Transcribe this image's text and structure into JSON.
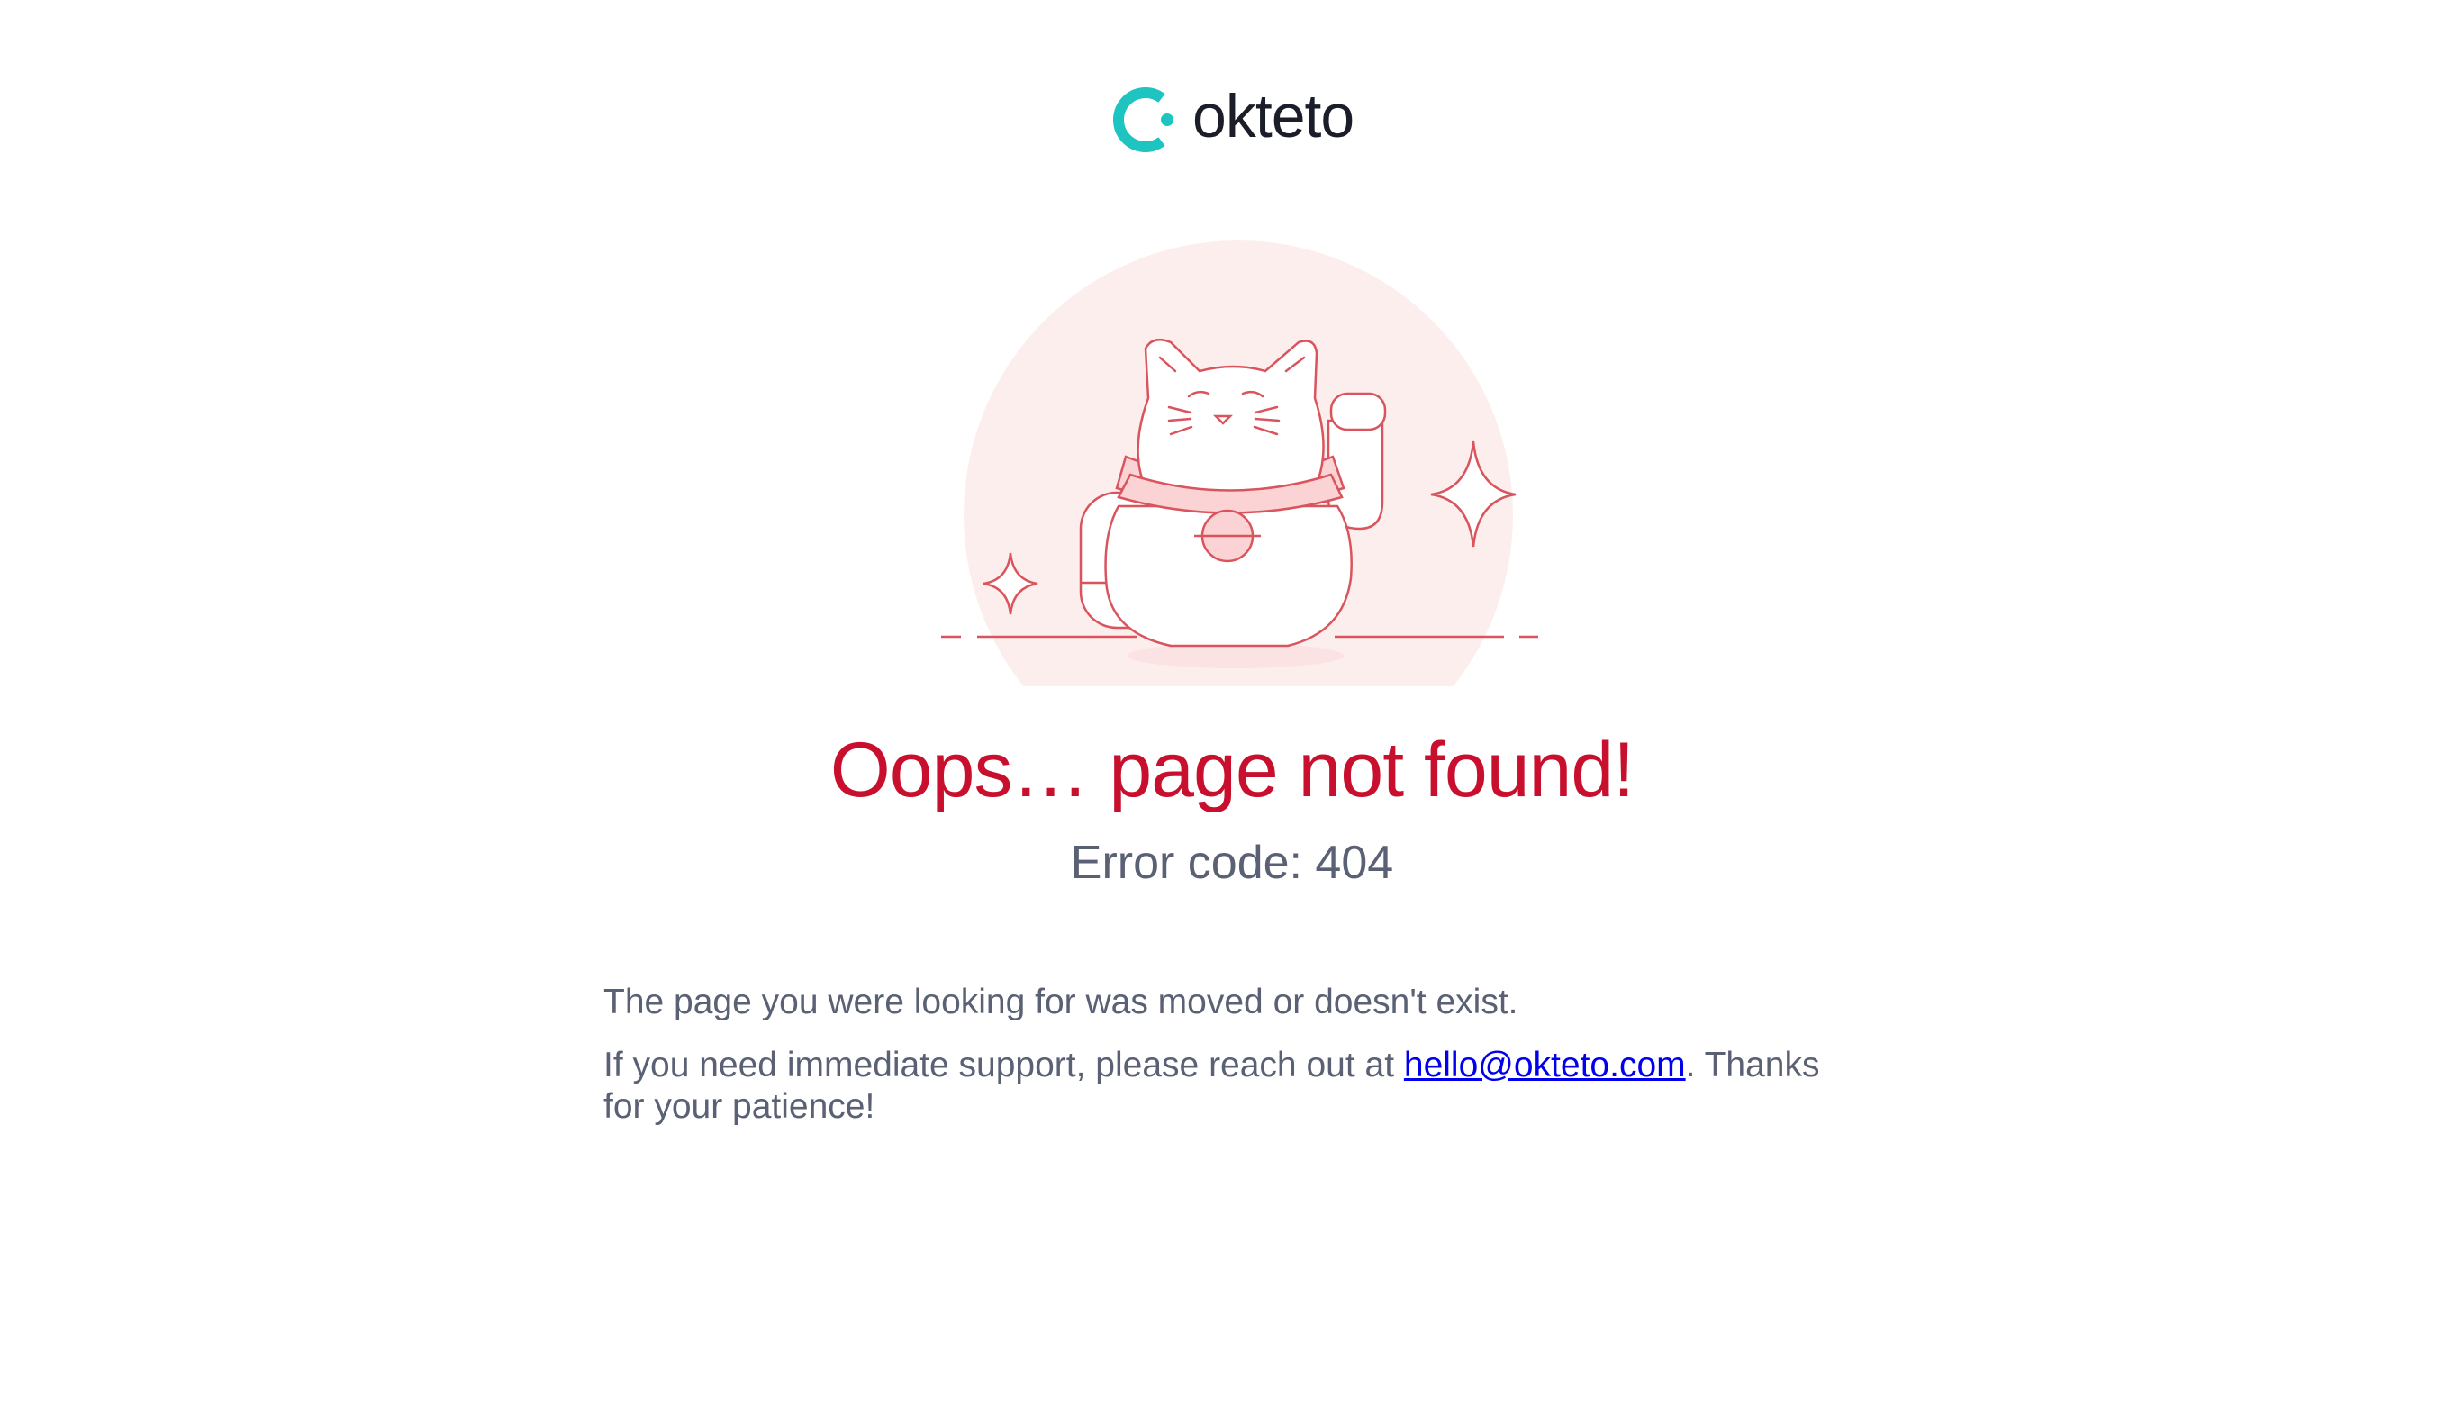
{
  "brand": {
    "name": "okteto",
    "logo_icon": "okteto-ring-icon",
    "accent_color": "#1ec5c0"
  },
  "illustration": {
    "icon": "lucky-cat-icon",
    "circle_color": "#fdeeee",
    "line_color": "#d9545c"
  },
  "error": {
    "title": "Oops… page not found!",
    "code": "Error code: 404",
    "title_color": "#c8102e"
  },
  "message": {
    "line1": "The page you were looking for was moved or doesn't exist.",
    "line2_before": "If you need immediate support, please reach out at ",
    "email": "hello@okteto.com",
    "line2_after": ". Thanks for your patience!"
  }
}
